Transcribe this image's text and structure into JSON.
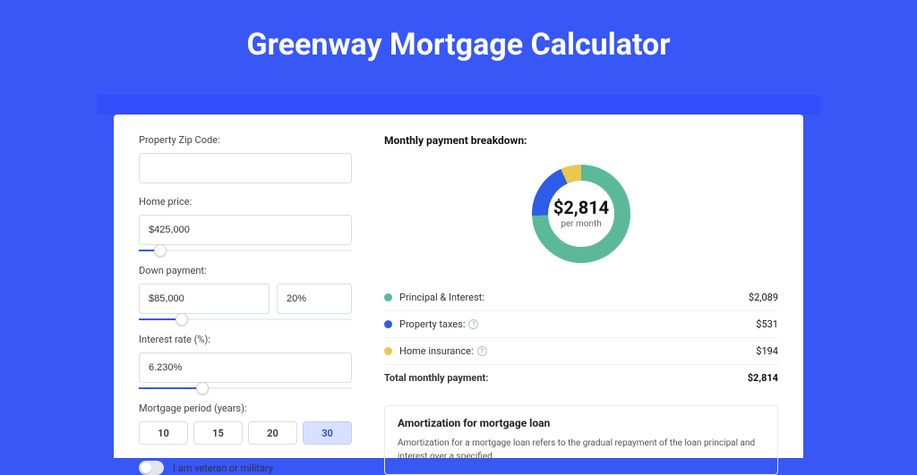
{
  "page": {
    "title": "Greenway Mortgage Calculator"
  },
  "form": {
    "zip_label": "Property Zip Code:",
    "zip_value": "",
    "home_price_label": "Home price:",
    "home_price_value": "$425,000",
    "down_label": "Down payment:",
    "down_value": "$85,000",
    "down_pct": "20%",
    "rate_label": "Interest rate (%):",
    "rate_value": "6.230%",
    "period_label": "Mortgage period (years):",
    "periods": [
      "10",
      "15",
      "20",
      "30"
    ],
    "selected_period_index": 3,
    "veteran_label": "I am veteran or military"
  },
  "breakdown": {
    "title": "Monthly payment breakdown:",
    "center_value": "$2,814",
    "center_sub": "per month",
    "items": [
      {
        "key": "principal",
        "label": "Principal & Interest:",
        "value": "$2,089",
        "color": "green",
        "info": false,
        "amount": 2089
      },
      {
        "key": "taxes",
        "label": "Property taxes:",
        "value": "$531",
        "color": "blue",
        "info": true,
        "amount": 531
      },
      {
        "key": "insurance",
        "label": "Home insurance:",
        "value": "$194",
        "color": "yellow",
        "info": true,
        "amount": 194
      }
    ],
    "total_label": "Total monthly payment:",
    "total_value": "$2,814"
  },
  "amort": {
    "title": "Amortization for mortgage loan",
    "text": "Amortization for a mortgage loan refers to the gradual repayment of the loan principal and interest over a specified"
  },
  "chart_data": {
    "type": "pie",
    "title": "Monthly payment breakdown",
    "categories": [
      "Principal & Interest",
      "Property taxes",
      "Home insurance"
    ],
    "values": [
      2089,
      531,
      194
    ],
    "colors": {
      "Principal & Interest": "#5bb99a",
      "Property taxes": "#2d5ce6",
      "Home insurance": "#e8c84f"
    },
    "center_label": "$2,814 per month"
  }
}
